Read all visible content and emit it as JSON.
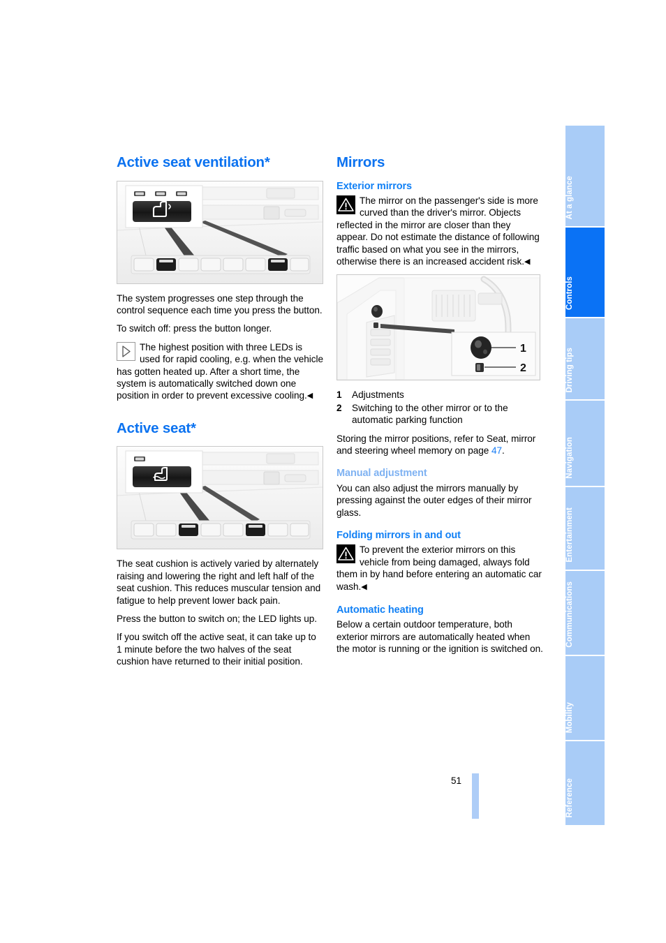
{
  "page": {
    "number": "51",
    "folio_bar_color": "#aecdf7"
  },
  "colors": {
    "heading_blue": "#0b72f0",
    "subheading_blue": "#1180f5",
    "subheading_faded_blue": "#7fb2f2",
    "tab_inactive": "#a9ccf7",
    "tab_active": "#0a72f5",
    "link_blue": "#1a7ef5"
  },
  "left_column": {
    "section1": {
      "title": "Active seat ventilation*",
      "figure": {
        "name": "seat-ventilation-button-figure",
        "credit": "",
        "led_count": 3,
        "caption": ""
      },
      "paragraphs": [
        "The system progresses one step through the control sequence each time you press the button.",
        "To switch off: press the button longer."
      ],
      "note": {
        "icon": "note-triangle-icon",
        "text": "The highest position with three LEDs is used for rapid cooling, e.g. when the vehicle has gotten heated up. After a short time, the system is automatically switched down one position in order to prevent excessive cooling.",
        "endmark": "◀"
      }
    },
    "section2": {
      "title": "Active seat*",
      "figure": {
        "name": "active-seat-button-figure",
        "credit": "",
        "led_count": 1
      },
      "paragraphs": [
        "The seat cushion is actively varied by alternately raising and lowering the right and left half of the seat cushion. This reduces muscular tension and fatigue to help prevent lower back pain.",
        "Press the button to switch on; the LED lights up.",
        "If you switch off the active seat, it can take up to 1 minute before the two halves of the seat cushion have returned to their initial position."
      ]
    }
  },
  "right_column": {
    "section_title": "Mirrors",
    "subsections": [
      {
        "id": "exterior-mirrors",
        "title": "Exterior mirrors",
        "faded": false,
        "warning": {
          "icon": "warning-triangle-icon",
          "text": "The mirror on the passenger's side is more curved than the driver's mirror. Objects reflected in the mirror are closer than they appear. Do not estimate the distance of following traffic based on what you see in the mirrors, otherwise there is an increased accident risk.",
          "endmark": "◀"
        }
      }
    ],
    "figure": {
      "name": "mirror-controls-figure",
      "credit": "",
      "callout_labels": [
        "1",
        "2"
      ]
    },
    "legend": [
      {
        "num": "1",
        "text": "Adjustments"
      },
      {
        "num": "2",
        "text": "Switching to the other mirror or to the automatic parking function"
      }
    ],
    "cross_reference": {
      "before": "Storing the mirror positions, refer to Seat, mirror and steering wheel memory on page ",
      "page": "47",
      "after": "."
    },
    "manual_adjustment": {
      "title": "Manual adjustment",
      "text": "You can also adjust the mirrors manually by pressing against the outer edges of their mirror glass."
    },
    "folding_mirrors": {
      "title": "Folding mirrors in and out",
      "warning": {
        "icon": "warning-triangle-icon",
        "text": "To prevent the exterior mirrors on this vehicle from being damaged, always fold them in by hand before entering an automatic car wash.",
        "endmark": "◀"
      }
    },
    "automatic_heating": {
      "title": "Automatic heating",
      "text": "Below a certain outdoor temperature, both exterior mirrors are automatically heated when the motor is running or the ignition is switched on."
    }
  },
  "tabs": [
    {
      "label": "At a glance",
      "active": false
    },
    {
      "label": "Controls",
      "active": true
    },
    {
      "label": "Driving tips",
      "active": false
    },
    {
      "label": "Navigation",
      "active": false
    },
    {
      "label": "Entertainment",
      "active": false
    },
    {
      "label": "Communications",
      "active": false
    },
    {
      "label": "Mobility",
      "active": false
    },
    {
      "label": "Reference",
      "active": false
    }
  ]
}
